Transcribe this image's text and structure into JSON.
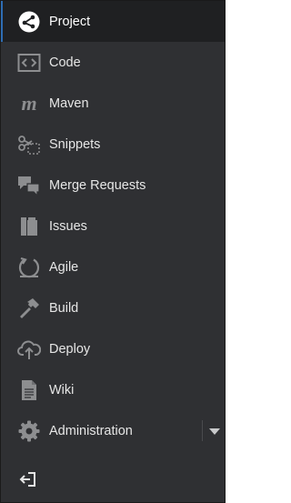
{
  "nav": {
    "items": [
      {
        "label": "Project",
        "icon": "project-icon",
        "active": true
      },
      {
        "label": "Code",
        "icon": "code-icon"
      },
      {
        "label": "Maven",
        "icon": "maven-icon"
      },
      {
        "label": "Snippets",
        "icon": "snippets-icon"
      },
      {
        "label": "Merge Requests",
        "icon": "merge-requests-icon"
      },
      {
        "label": "Issues",
        "icon": "issues-icon"
      },
      {
        "label": "Agile",
        "icon": "agile-icon"
      },
      {
        "label": "Build",
        "icon": "build-icon"
      },
      {
        "label": "Deploy",
        "icon": "deploy-icon"
      },
      {
        "label": "Wiki",
        "icon": "wiki-icon"
      },
      {
        "label": "Administration",
        "icon": "gear-icon"
      }
    ]
  },
  "colors": {
    "background": "#2f3033",
    "active_background": "#1f2022",
    "text": "#e6e6e6",
    "icon": "#8d8e90",
    "accent": "#2e6db4"
  }
}
